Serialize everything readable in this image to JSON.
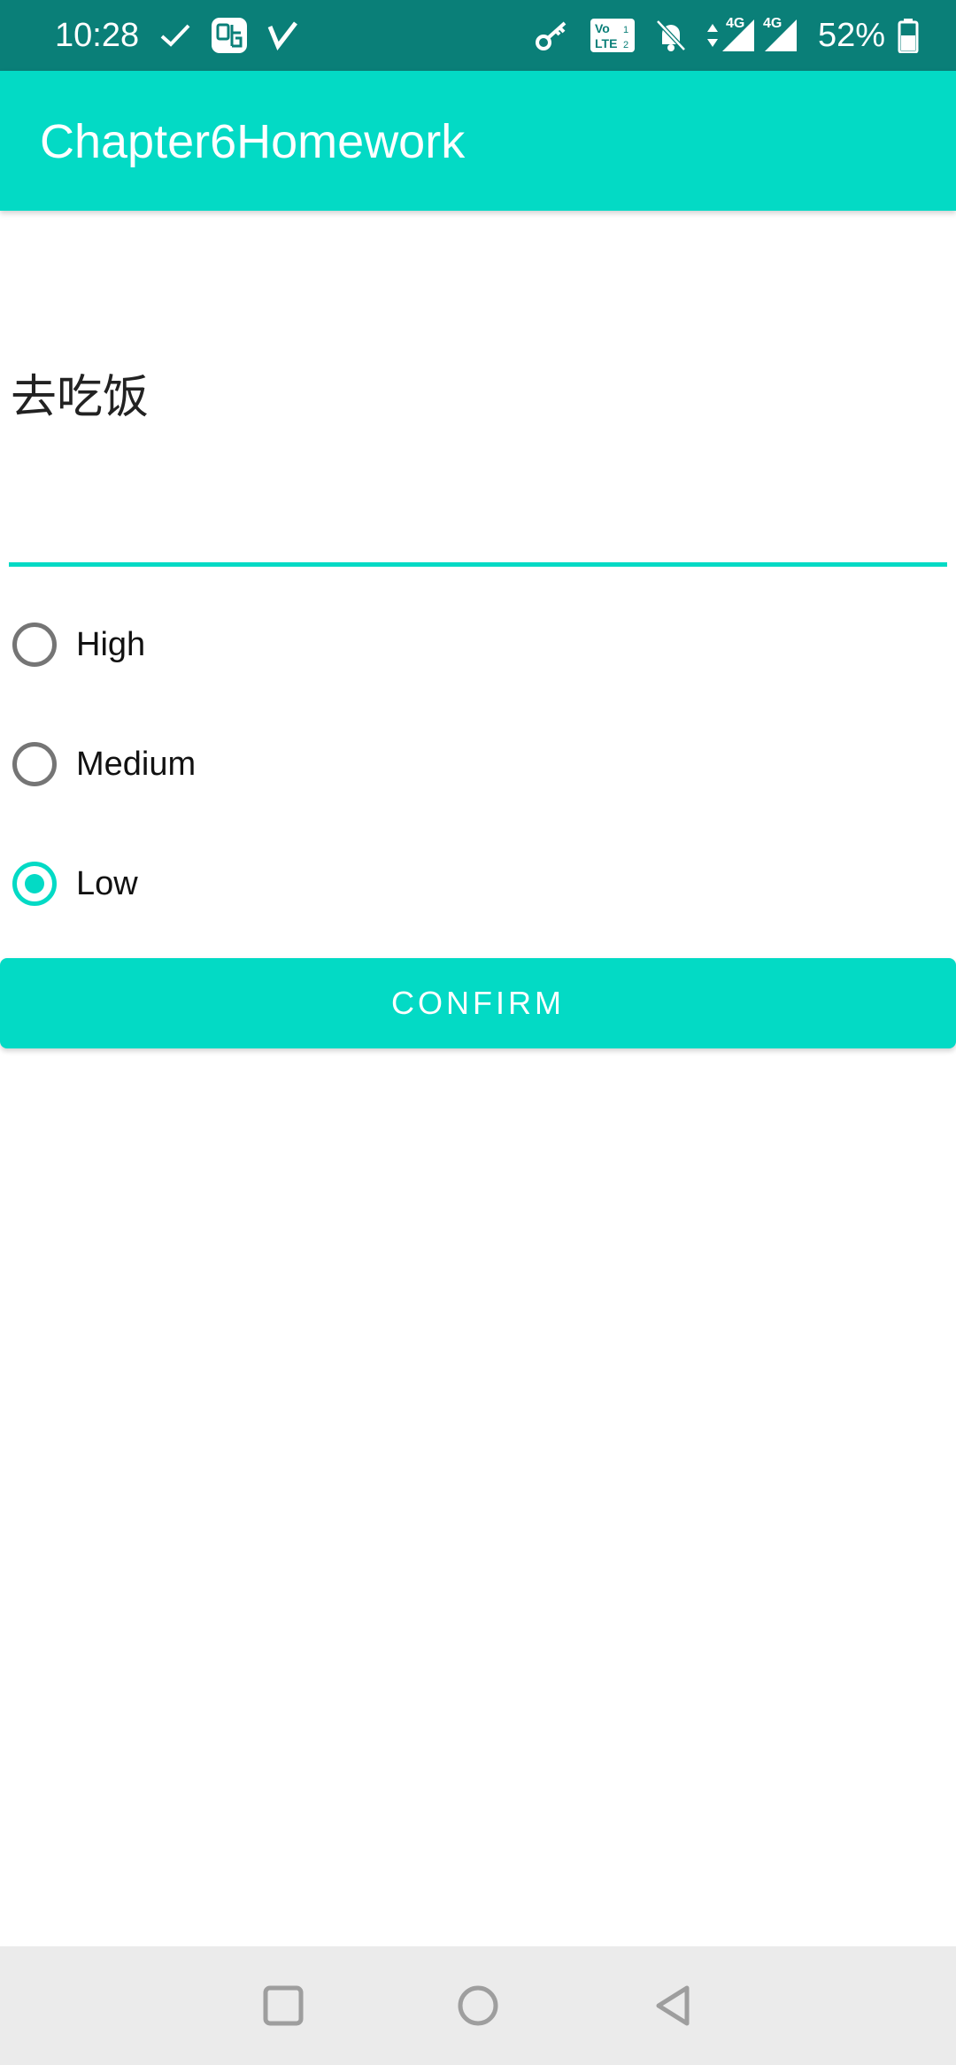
{
  "status_bar": {
    "time": "10:28",
    "battery": "52%",
    "left_icons": [
      "check-icon",
      "tieba-app-icon",
      "v-app-icon"
    ],
    "right_icons": [
      "key-icon",
      "volte-icon",
      "bell-off-icon",
      "data-arrows-icon",
      "signal-4g-icon",
      "signal-4g-2-icon",
      "battery-icon"
    ],
    "network_label_1": "4G",
    "network_label_2": "4G",
    "volte_top": "Vo",
    "volte_bottom": "LTE"
  },
  "app_bar": {
    "title": "Chapter6Homework"
  },
  "todo_input": {
    "value": "去吃饭"
  },
  "priority": {
    "options": [
      {
        "label": "High",
        "checked": false
      },
      {
        "label": "Medium",
        "checked": false
      },
      {
        "label": "Low",
        "checked": true
      }
    ]
  },
  "confirm": {
    "label": "CONFIRM"
  },
  "nav_bar": {
    "buttons": [
      "recent-apps-icon",
      "home-icon",
      "back-icon"
    ]
  },
  "colors": {
    "accent": "#03dac5",
    "status_bar": "#0a7f78",
    "nav_bar": "#ebebeb"
  }
}
